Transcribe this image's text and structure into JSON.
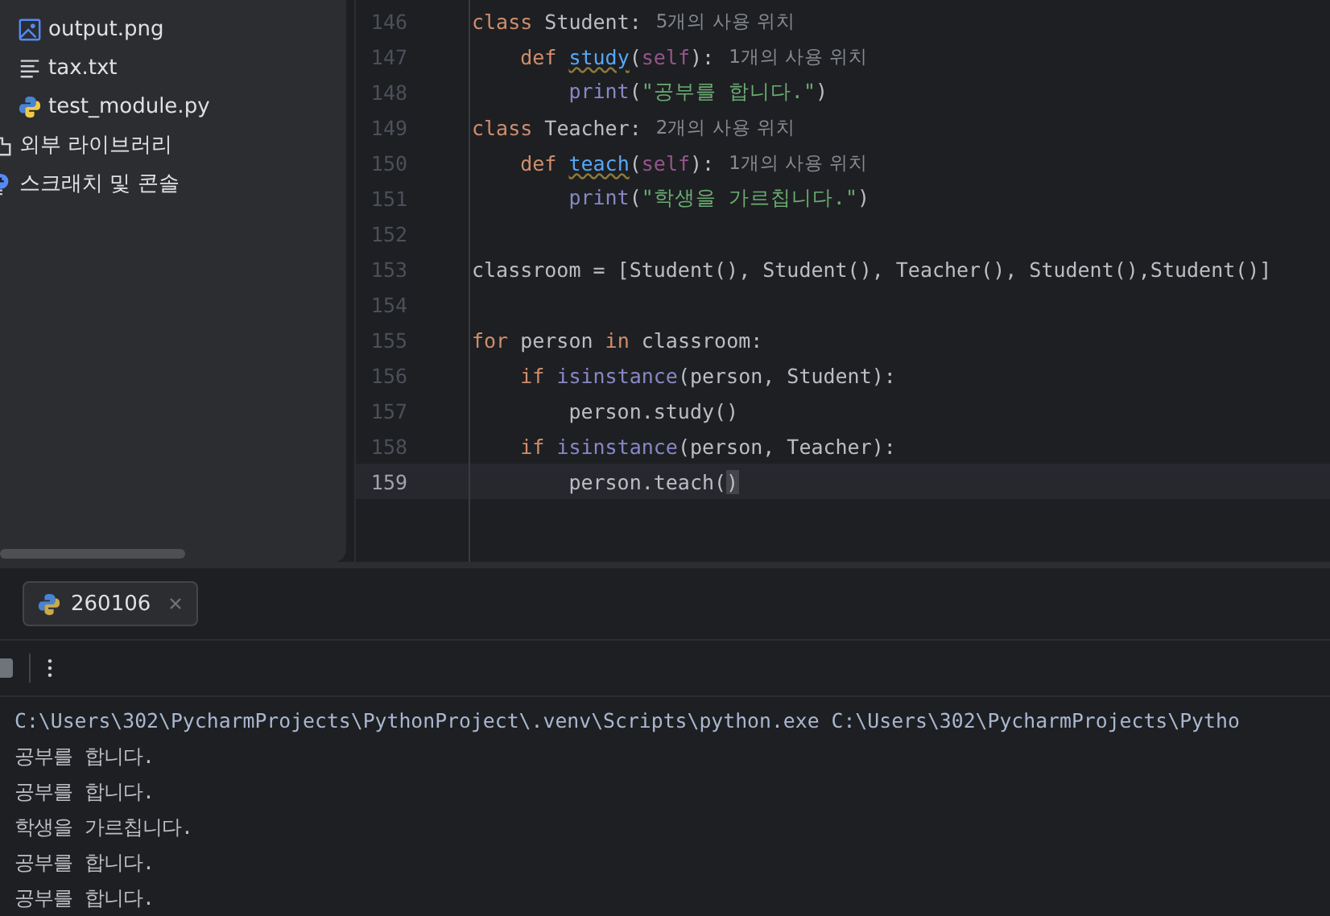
{
  "project_tree": {
    "items": [
      {
        "name": "output.png",
        "kind": "image"
      },
      {
        "name": "tax.txt",
        "kind": "text"
      },
      {
        "name": "test_module.py",
        "kind": "python"
      },
      {
        "name": "외부 라이브러리",
        "kind": "library"
      },
      {
        "name": "스크래치 및 콘솔",
        "kind": "scratch"
      }
    ]
  },
  "editor": {
    "lines": [
      {
        "number": "146",
        "current": false,
        "tokens": [
          {
            "text": "class",
            "kind": "keyword"
          },
          {
            "text": " Student:",
            "kind": "plain"
          }
        ],
        "hint": "5개의 사용 위치"
      },
      {
        "number": "147",
        "current": false,
        "tokens": [
          {
            "text": "    def ",
            "kind": "keyword"
          },
          {
            "text": "study",
            "kind": "function"
          },
          {
            "text": "(",
            "kind": "plain"
          },
          {
            "text": "self",
            "kind": "self"
          },
          {
            "text": "):",
            "kind": "plain"
          }
        ],
        "hint": "1개의 사용 위치"
      },
      {
        "number": "148",
        "current": false,
        "tokens": [
          {
            "text": "        print",
            "kind": "builtin"
          },
          {
            "text": "(",
            "kind": "plain"
          },
          {
            "text": "\"공부를 합니다.\"",
            "kind": "string"
          },
          {
            "text": ")",
            "kind": "plain"
          }
        ]
      },
      {
        "number": "149",
        "current": false,
        "tokens": [
          {
            "text": "class",
            "kind": "keyword"
          },
          {
            "text": " Teacher:",
            "kind": "plain"
          }
        ],
        "hint": "2개의 사용 위치"
      },
      {
        "number": "150",
        "current": false,
        "tokens": [
          {
            "text": "    def ",
            "kind": "keyword"
          },
          {
            "text": "teach",
            "kind": "function"
          },
          {
            "text": "(",
            "kind": "plain"
          },
          {
            "text": "self",
            "kind": "self"
          },
          {
            "text": "):",
            "kind": "plain"
          }
        ],
        "hint": "1개의 사용 위치"
      },
      {
        "number": "151",
        "current": false,
        "tokens": [
          {
            "text": "        print",
            "kind": "builtin"
          },
          {
            "text": "(",
            "kind": "plain"
          },
          {
            "text": "\"학생을 가르칩니다.\"",
            "kind": "string"
          },
          {
            "text": ")",
            "kind": "plain"
          }
        ]
      },
      {
        "number": "152",
        "current": false
      },
      {
        "number": "153",
        "current": false,
        "tokens": [
          {
            "text": "classroom = [Student(), Student(), Teacher(), Student(),Student()]",
            "kind": "plain"
          }
        ]
      },
      {
        "number": "154",
        "current": false
      },
      {
        "number": "155",
        "current": false,
        "tokens": [
          {
            "text": "for",
            "kind": "keyword"
          },
          {
            "text": " person ",
            "kind": "plain"
          },
          {
            "text": "in",
            "kind": "keyword"
          },
          {
            "text": " classroom:",
            "kind": "plain"
          }
        ]
      },
      {
        "number": "156",
        "current": false,
        "tokens": [
          {
            "text": "    if ",
            "kind": "keyword"
          },
          {
            "text": "isinstance",
            "kind": "builtin"
          },
          {
            "text": "(person, Student):",
            "kind": "plain"
          }
        ]
      },
      {
        "number": "157",
        "current": false,
        "tokens": [
          {
            "text": "        person.study()",
            "kind": "plain"
          }
        ]
      },
      {
        "number": "158",
        "current": false,
        "tokens": [
          {
            "text": "    if ",
            "kind": "keyword"
          },
          {
            "text": "isinstance",
            "kind": "builtin"
          },
          {
            "text": "(person, Teacher):",
            "kind": "plain"
          }
        ]
      },
      {
        "number": "159",
        "current": true,
        "tokens": [
          {
            "text": "        person.teach(",
            "kind": "plain"
          },
          {
            "text": ")",
            "kind": "bracket"
          }
        ]
      }
    ]
  },
  "run_panel": {
    "tab": {
      "label": "260106",
      "selected": true
    },
    "output": [
      "C:\\Users\\302\\PycharmProjects\\PythonProject\\.venv\\Scripts\\python.exe C:\\Users\\302\\PycharmProjects\\Pytho",
      "공부를 합니다.",
      "공부를 합니다.",
      "학생을 가르칩니다.",
      "공부를 합니다.",
      "공부를 합니다."
    ]
  }
}
